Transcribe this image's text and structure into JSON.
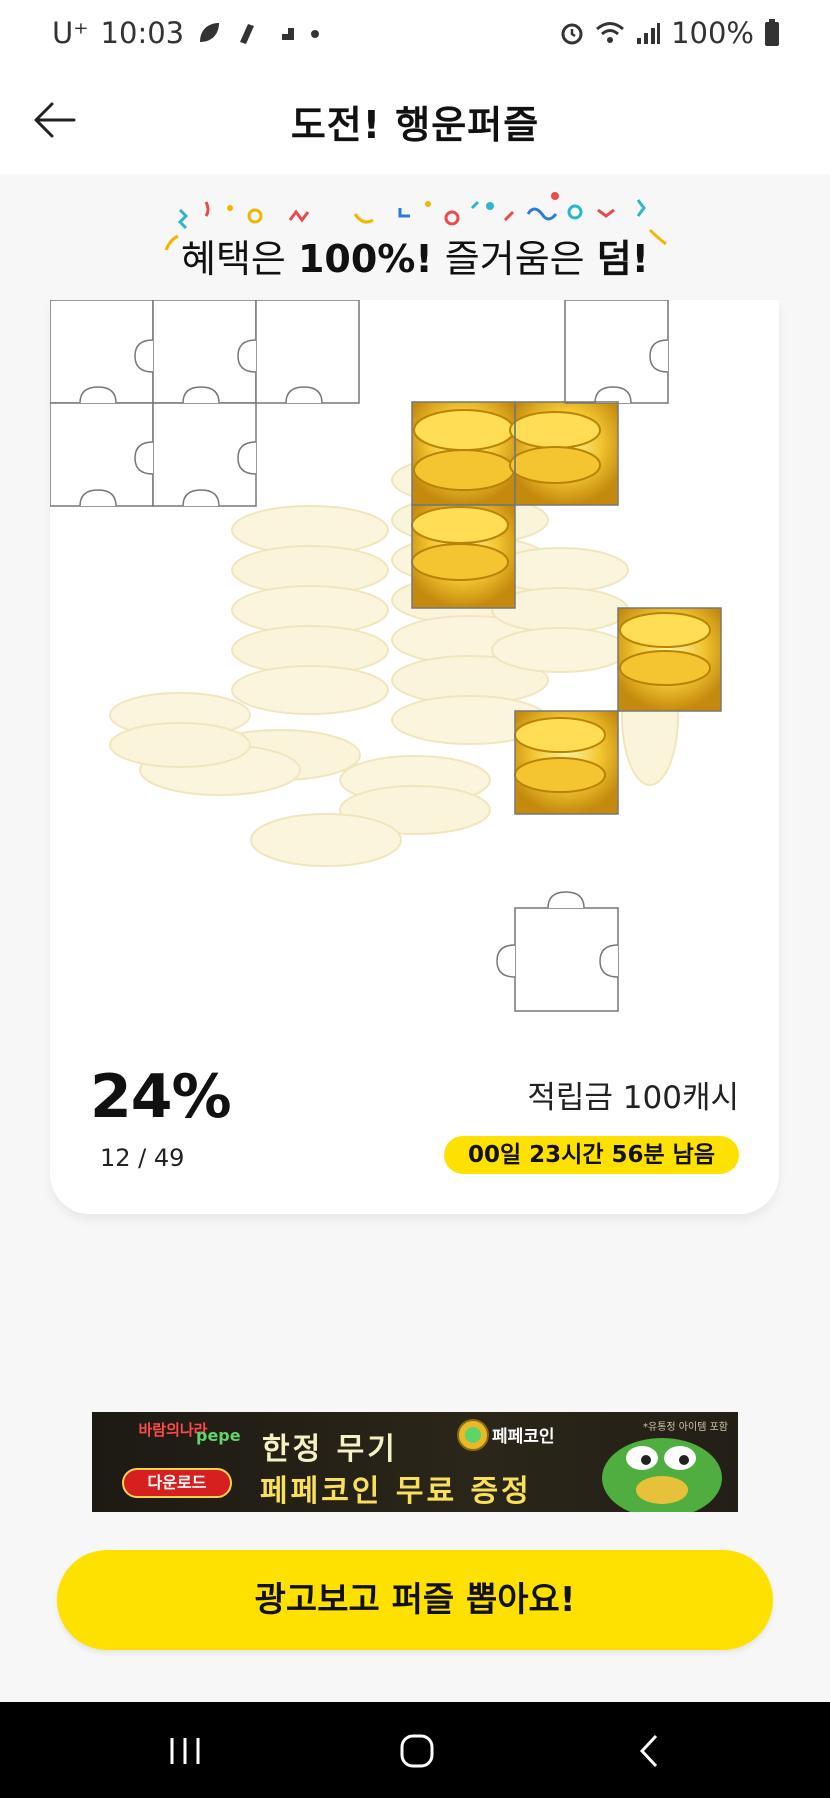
{
  "status_bar": {
    "carrier": "U⁺",
    "time": "10:03",
    "battery": "100%",
    "icons": [
      "leaf-icon",
      "gesture-icon",
      "step-icon",
      "dot-icon",
      "alarm-icon",
      "wifi-icon",
      "signal-icon",
      "battery-icon"
    ]
  },
  "app_bar": {
    "title": "도전! 행운퍼즐",
    "back_icon": "arrow-left-icon"
  },
  "headline": {
    "part1": "혜택은 ",
    "bold1": "100%!",
    "part2": " 즐거움은 ",
    "bold2": "덤!"
  },
  "puzzle": {
    "grid_columns": 7,
    "progress_percent": "24%",
    "progress_count": "12 / 49",
    "reward": "적립금 100캐시",
    "time_left": "00일 23시간 56분 남음"
  },
  "banner": {
    "brand": "바람의나라",
    "partner": "pepe",
    "download_label": "다운로드",
    "line1": "한정 무기",
    "line2": "페페코인 무료 증정",
    "coin_name": "페페코인",
    "corner_note": "*유통정 아이템 포함"
  },
  "cta": {
    "label": "광고보고 퍼즐 뽑아요!"
  },
  "colors": {
    "accent_yellow": "#ffe100",
    "background": "#f7f7f7",
    "nav_bar": "#000000"
  }
}
